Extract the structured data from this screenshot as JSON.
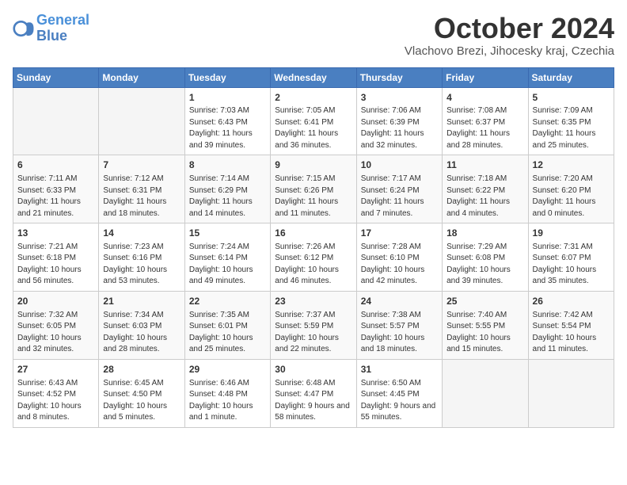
{
  "header": {
    "logo_line1": "General",
    "logo_line2": "Blue",
    "month": "October 2024",
    "location": "Vlachovo Brezi, Jihocesky kraj, Czechia"
  },
  "weekdays": [
    "Sunday",
    "Monday",
    "Tuesday",
    "Wednesday",
    "Thursday",
    "Friday",
    "Saturday"
  ],
  "weeks": [
    [
      {
        "day": "",
        "info": ""
      },
      {
        "day": "",
        "info": ""
      },
      {
        "day": "1",
        "info": "Sunrise: 7:03 AM\nSunset: 6:43 PM\nDaylight: 11 hours and 39 minutes."
      },
      {
        "day": "2",
        "info": "Sunrise: 7:05 AM\nSunset: 6:41 PM\nDaylight: 11 hours and 36 minutes."
      },
      {
        "day": "3",
        "info": "Sunrise: 7:06 AM\nSunset: 6:39 PM\nDaylight: 11 hours and 32 minutes."
      },
      {
        "day": "4",
        "info": "Sunrise: 7:08 AM\nSunset: 6:37 PM\nDaylight: 11 hours and 28 minutes."
      },
      {
        "day": "5",
        "info": "Sunrise: 7:09 AM\nSunset: 6:35 PM\nDaylight: 11 hours and 25 minutes."
      }
    ],
    [
      {
        "day": "6",
        "info": "Sunrise: 7:11 AM\nSunset: 6:33 PM\nDaylight: 11 hours and 21 minutes."
      },
      {
        "day": "7",
        "info": "Sunrise: 7:12 AM\nSunset: 6:31 PM\nDaylight: 11 hours and 18 minutes."
      },
      {
        "day": "8",
        "info": "Sunrise: 7:14 AM\nSunset: 6:29 PM\nDaylight: 11 hours and 14 minutes."
      },
      {
        "day": "9",
        "info": "Sunrise: 7:15 AM\nSunset: 6:26 PM\nDaylight: 11 hours and 11 minutes."
      },
      {
        "day": "10",
        "info": "Sunrise: 7:17 AM\nSunset: 6:24 PM\nDaylight: 11 hours and 7 minutes."
      },
      {
        "day": "11",
        "info": "Sunrise: 7:18 AM\nSunset: 6:22 PM\nDaylight: 11 hours and 4 minutes."
      },
      {
        "day": "12",
        "info": "Sunrise: 7:20 AM\nSunset: 6:20 PM\nDaylight: 11 hours and 0 minutes."
      }
    ],
    [
      {
        "day": "13",
        "info": "Sunrise: 7:21 AM\nSunset: 6:18 PM\nDaylight: 10 hours and 56 minutes."
      },
      {
        "day": "14",
        "info": "Sunrise: 7:23 AM\nSunset: 6:16 PM\nDaylight: 10 hours and 53 minutes."
      },
      {
        "day": "15",
        "info": "Sunrise: 7:24 AM\nSunset: 6:14 PM\nDaylight: 10 hours and 49 minutes."
      },
      {
        "day": "16",
        "info": "Sunrise: 7:26 AM\nSunset: 6:12 PM\nDaylight: 10 hours and 46 minutes."
      },
      {
        "day": "17",
        "info": "Sunrise: 7:28 AM\nSunset: 6:10 PM\nDaylight: 10 hours and 42 minutes."
      },
      {
        "day": "18",
        "info": "Sunrise: 7:29 AM\nSunset: 6:08 PM\nDaylight: 10 hours and 39 minutes."
      },
      {
        "day": "19",
        "info": "Sunrise: 7:31 AM\nSunset: 6:07 PM\nDaylight: 10 hours and 35 minutes."
      }
    ],
    [
      {
        "day": "20",
        "info": "Sunrise: 7:32 AM\nSunset: 6:05 PM\nDaylight: 10 hours and 32 minutes."
      },
      {
        "day": "21",
        "info": "Sunrise: 7:34 AM\nSunset: 6:03 PM\nDaylight: 10 hours and 28 minutes."
      },
      {
        "day": "22",
        "info": "Sunrise: 7:35 AM\nSunset: 6:01 PM\nDaylight: 10 hours and 25 minutes."
      },
      {
        "day": "23",
        "info": "Sunrise: 7:37 AM\nSunset: 5:59 PM\nDaylight: 10 hours and 22 minutes."
      },
      {
        "day": "24",
        "info": "Sunrise: 7:38 AM\nSunset: 5:57 PM\nDaylight: 10 hours and 18 minutes."
      },
      {
        "day": "25",
        "info": "Sunrise: 7:40 AM\nSunset: 5:55 PM\nDaylight: 10 hours and 15 minutes."
      },
      {
        "day": "26",
        "info": "Sunrise: 7:42 AM\nSunset: 5:54 PM\nDaylight: 10 hours and 11 minutes."
      }
    ],
    [
      {
        "day": "27",
        "info": "Sunrise: 6:43 AM\nSunset: 4:52 PM\nDaylight: 10 hours and 8 minutes."
      },
      {
        "day": "28",
        "info": "Sunrise: 6:45 AM\nSunset: 4:50 PM\nDaylight: 10 hours and 5 minutes."
      },
      {
        "day": "29",
        "info": "Sunrise: 6:46 AM\nSunset: 4:48 PM\nDaylight: 10 hours and 1 minute."
      },
      {
        "day": "30",
        "info": "Sunrise: 6:48 AM\nSunset: 4:47 PM\nDaylight: 9 hours and 58 minutes."
      },
      {
        "day": "31",
        "info": "Sunrise: 6:50 AM\nSunset: 4:45 PM\nDaylight: 9 hours and 55 minutes."
      },
      {
        "day": "",
        "info": ""
      },
      {
        "day": "",
        "info": ""
      }
    ]
  ]
}
